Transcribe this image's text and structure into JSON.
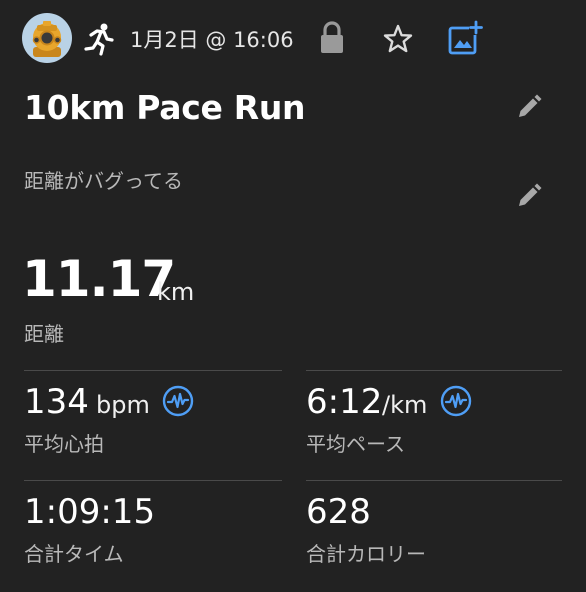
{
  "header": {
    "date_time": "1月2日 @ 16:06",
    "avatar_icon": "diving-helmet-icon",
    "activity_icon": "running-person-icon",
    "lock_icon": "lock-icon",
    "favorite_icon": "star-outline-icon",
    "add_photo_icon": "add-photo-icon"
  },
  "activity": {
    "title": "10km Pace Run",
    "note": "距離がバグってる"
  },
  "distance": {
    "value": "11.17",
    "unit": "km",
    "label": "距離"
  },
  "stats": {
    "heart_rate": {
      "value": "134",
      "unit": "bpm",
      "label": "平均心拍",
      "icon": "pulse-chart-icon"
    },
    "pace": {
      "value": "6:12",
      "unit": "/km",
      "label": "平均ペース",
      "icon": "pulse-chart-icon"
    },
    "total_time": {
      "value": "1:09:15",
      "label": "合計タイム"
    },
    "calories": {
      "value": "628",
      "label": "合計カロリー"
    }
  },
  "colors": {
    "background": "#222222",
    "accent_blue": "#4f9ef5",
    "avatar_bg": "#b9d2e6",
    "helmet_gold": "#e8a62c"
  }
}
